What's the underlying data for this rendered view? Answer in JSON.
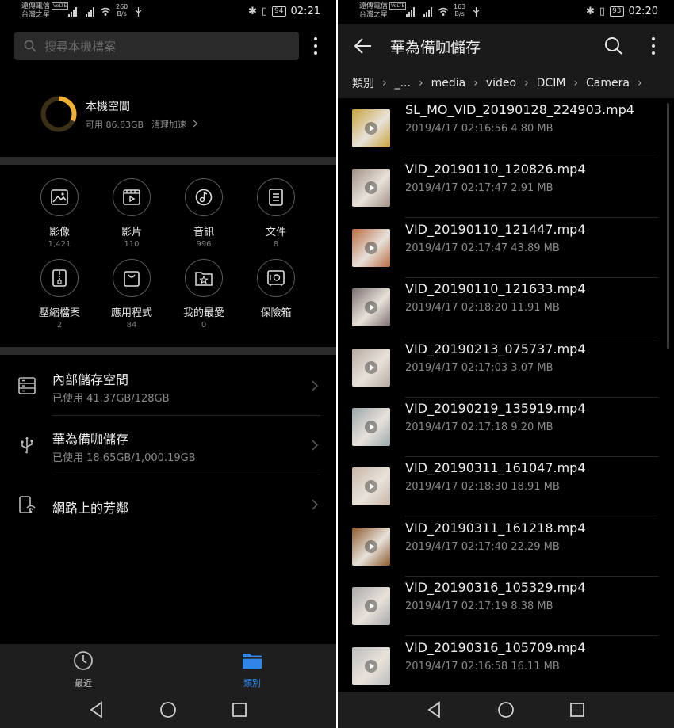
{
  "left": {
    "status": {
      "carrier_line1": "遠傳電信",
      "carrier_line2": "台灣之星",
      "volte": "VoLTE",
      "speed_value": "260",
      "speed_unit": "B/s",
      "battery": "94",
      "time": "02:21"
    },
    "search": {
      "placeholder": "搜尋本機檔案"
    },
    "storage": {
      "title": "本機空間",
      "available": "可用 86.63GB",
      "clean": "清理加速"
    },
    "categories": [
      {
        "label": "影像",
        "count": "1,421",
        "icon": "image-icon"
      },
      {
        "label": "影片",
        "count": "110",
        "icon": "video-icon"
      },
      {
        "label": "音訊",
        "count": "996",
        "icon": "music-icon"
      },
      {
        "label": "文件",
        "count": "8",
        "icon": "document-icon"
      },
      {
        "label": "壓縮檔案",
        "count": "2",
        "icon": "archive-icon"
      },
      {
        "label": "應用程式",
        "count": "84",
        "icon": "app-bag-icon"
      },
      {
        "label": "我的最愛",
        "count": "0",
        "icon": "favorite-folder-icon"
      },
      {
        "label": "保險箱",
        "count": "",
        "icon": "safe-icon"
      }
    ],
    "locations": [
      {
        "title": "內部儲存空間",
        "sub": "已使用 41.37GB/128GB",
        "icon": "internal-storage-icon"
      },
      {
        "title": "華為備咖儲存",
        "sub": "已使用 18.65GB/1,000.19GB",
        "icon": "usb-icon"
      },
      {
        "title": "網路上的芳鄰",
        "sub": "",
        "icon": "network-neighborhood-icon"
      }
    ],
    "tabs": [
      {
        "label": "最近",
        "icon": "clock-icon",
        "active": false
      },
      {
        "label": "類別",
        "icon": "folder-icon",
        "active": true
      }
    ],
    "accent": "#2f86e8",
    "ring_fraction": 0.32
  },
  "right": {
    "status": {
      "carrier_line1": "遠傳電信",
      "carrier_line2": "台灣之星",
      "volte": "VoLTE",
      "speed_value": "163",
      "speed_unit": "B/s",
      "battery": "93",
      "time": "02:20"
    },
    "title": "華為備咖儲存",
    "breadcrumbs": [
      "類別",
      "_...",
      "media",
      "video",
      "DCIM",
      "Camera"
    ],
    "files": [
      {
        "name": "SL_MO_VID_20190128_224903.mp4",
        "meta": "2019/4/17 02:16:56 4.80 MB",
        "color": "#c8a23a"
      },
      {
        "name": "VID_20190110_120826.mp4",
        "meta": "2019/4/17 02:17:47 2.91 MB",
        "color": "#a08f83"
      },
      {
        "name": "VID_20190110_121447.mp4",
        "meta": "2019/4/17 02:17:47 43.89 MB",
        "color": "#b86a40"
      },
      {
        "name": "VID_20190110_121633.mp4",
        "meta": "2019/4/17 02:18:20 11.91 MB",
        "color": "#7d6e70"
      },
      {
        "name": "VID_20190213_075737.mp4",
        "meta": "2019/4/17 02:17:03 3.07 MB",
        "color": "#b6a9a0"
      },
      {
        "name": "VID_20190219_135919.mp4",
        "meta": "2019/4/17 02:17:18 9.20 MB",
        "color": "#9aa7ac"
      },
      {
        "name": "VID_20190311_161047.mp4",
        "meta": "2019/4/17 02:18:30 18.91 MB",
        "color": "#c7b6a6"
      },
      {
        "name": "VID_20190311_161218.mp4",
        "meta": "2019/4/17 02:17:40 22.29 MB",
        "color": "#8b5a2e"
      },
      {
        "name": "VID_20190316_105329.mp4",
        "meta": "2019/4/17 02:17:19 8.38 MB",
        "color": "#a9a9a9"
      },
      {
        "name": "VID_20190316_105709.mp4",
        "meta": "2019/4/17 02:16:58 16.11 MB",
        "color": "#bcbcbc"
      }
    ]
  }
}
